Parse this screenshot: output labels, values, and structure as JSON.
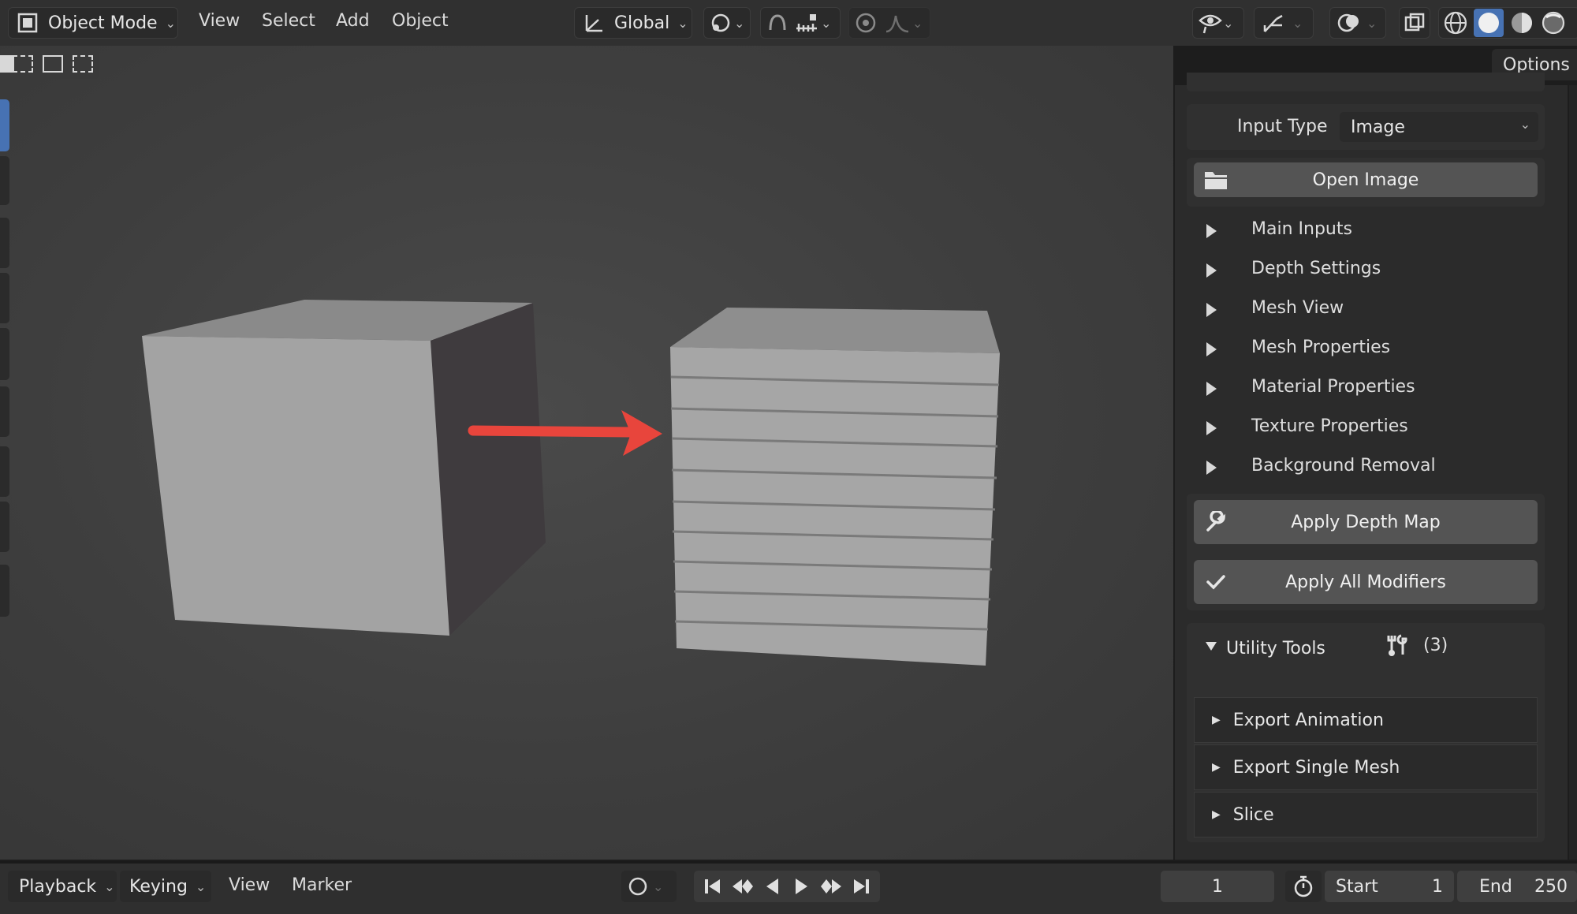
{
  "header": {
    "mode_label": "Object Mode",
    "menus": [
      "View",
      "Select",
      "Add",
      "Object"
    ],
    "orientation_label": "Global",
    "icons": [
      "object-mode-icon",
      "transform-orientation-icon",
      "pivot-icon",
      "snap-icon",
      "snap-increment-icon",
      "proportional-edit-icon",
      "falloff-icon",
      "visibility-icon",
      "gizmo-icon",
      "overlay-icon",
      "xray-icon",
      "wireframe-shading-icon",
      "solid-shading-icon",
      "material-shading-icon",
      "rendered-shading-icon"
    ]
  },
  "viewport": {
    "options_label": "Options",
    "arrow_color": "#e8453c"
  },
  "sidebar": {
    "input_type_label": "Input Type",
    "input_type_value": "Image",
    "open_image_label": "Open Image",
    "sections": [
      "Main Inputs",
      "Depth Settings",
      "Mesh View",
      "Mesh Properties",
      "Material Properties",
      "Texture Properties",
      "Background Removal"
    ],
    "apply_depth_label": "Apply Depth Map",
    "apply_modifiers_label": "Apply All Modifiers",
    "utility": {
      "title": "Utility Tools",
      "count": "(3)",
      "items": [
        "Export Animation",
        "Export Single Mesh",
        "Slice"
      ]
    }
  },
  "timeline": {
    "menus": [
      "Playback",
      "Keying",
      "View",
      "Marker"
    ],
    "current_frame": "1",
    "start_label": "Start",
    "start_value": "1",
    "end_label": "End",
    "end_value": "250"
  }
}
